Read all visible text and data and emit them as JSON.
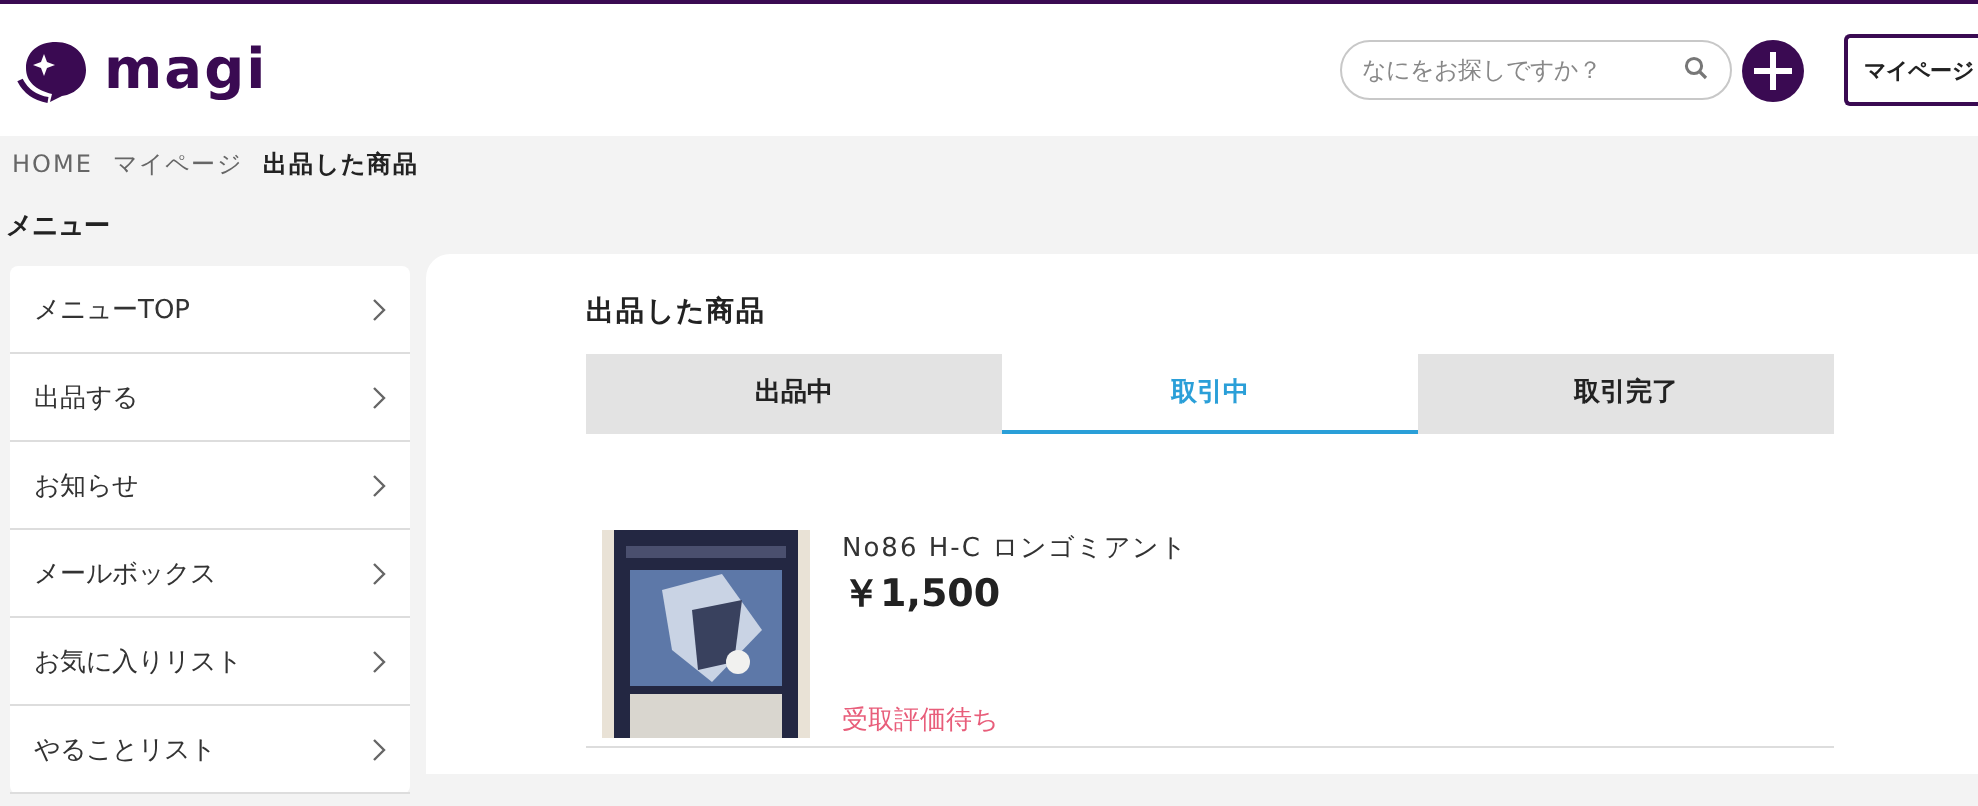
{
  "header": {
    "logo": "magi",
    "search": {
      "placeholder": "なにをお探しですか？"
    },
    "mypage_button": "マイページ"
  },
  "breadcrumb": [
    {
      "label": "HOME",
      "current": false
    },
    {
      "label": "マイページ",
      "current": false
    },
    {
      "label": "出品した商品",
      "current": true
    }
  ],
  "sidebar": {
    "title": "メニュー",
    "items": [
      {
        "label": "メニューTOP"
      },
      {
        "label": "出品する"
      },
      {
        "label": "お知らせ"
      },
      {
        "label": "メールボックス"
      },
      {
        "label": "お気に入りリスト"
      },
      {
        "label": "やることリスト"
      }
    ]
  },
  "main": {
    "title": "出品した商品",
    "tabs": [
      {
        "label": "出品中",
        "selected": false
      },
      {
        "label": "取引中",
        "selected": true
      },
      {
        "label": "取引完了",
        "selected": false
      }
    ],
    "items": [
      {
        "kind": "picture",
        "name": "No86 H-C ロンゴミアント",
        "price": "￥1,500",
        "status": "受取評価待ち"
      }
    ]
  }
}
